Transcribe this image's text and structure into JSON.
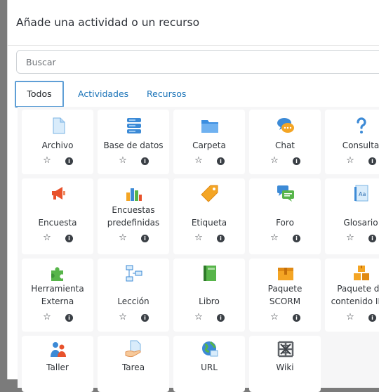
{
  "dialog": {
    "title": "Añade una actividad o un recurso"
  },
  "search": {
    "placeholder": "Buscar"
  },
  "tabs": [
    {
      "label": "Todos",
      "active": true
    },
    {
      "label": "Actividades",
      "active": false
    },
    {
      "label": "Recursos",
      "active": false
    }
  ],
  "items": [
    {
      "label": "Archivo",
      "icon": "file-icon"
    },
    {
      "label": "Base de datos",
      "icon": "database-icon"
    },
    {
      "label": "Carpeta",
      "icon": "folder-icon"
    },
    {
      "label": "Chat",
      "icon": "chat-icon"
    },
    {
      "label": "Consulta",
      "icon": "question-icon"
    },
    {
      "label": "Encuesta",
      "icon": "megaphone-icon"
    },
    {
      "label_line1": "Encuestas",
      "label_line2": "predefinidas",
      "icon": "bar-chart-icon"
    },
    {
      "label": "Etiqueta",
      "icon": "tag-icon"
    },
    {
      "label": "Foro",
      "icon": "forum-icon"
    },
    {
      "label": "Glosario",
      "icon": "glossary-icon"
    },
    {
      "label_line1": "Herramienta",
      "label_line2": "Externa",
      "icon": "puzzle-icon"
    },
    {
      "label": "Lección",
      "icon": "lesson-icon"
    },
    {
      "label": "Libro",
      "icon": "book-icon"
    },
    {
      "label_line1": "Paquete",
      "label_line2": "SCORM",
      "icon": "scorm-package-icon"
    },
    {
      "label_line1": "Paquete de",
      "label_line2": "contenido IMS",
      "icon": "ims-package-icon"
    },
    {
      "label": "Taller",
      "icon": "workshop-icon"
    },
    {
      "label": "Tarea",
      "icon": "assignment-icon"
    },
    {
      "label": "URL",
      "icon": "globe-icon"
    },
    {
      "label": "Wiki",
      "icon": "wiki-icon"
    }
  ],
  "colors": {
    "accent": "#1a73b8",
    "tab_border": "#5f9fd6",
    "grid_bg": "#f6f6f7"
  }
}
